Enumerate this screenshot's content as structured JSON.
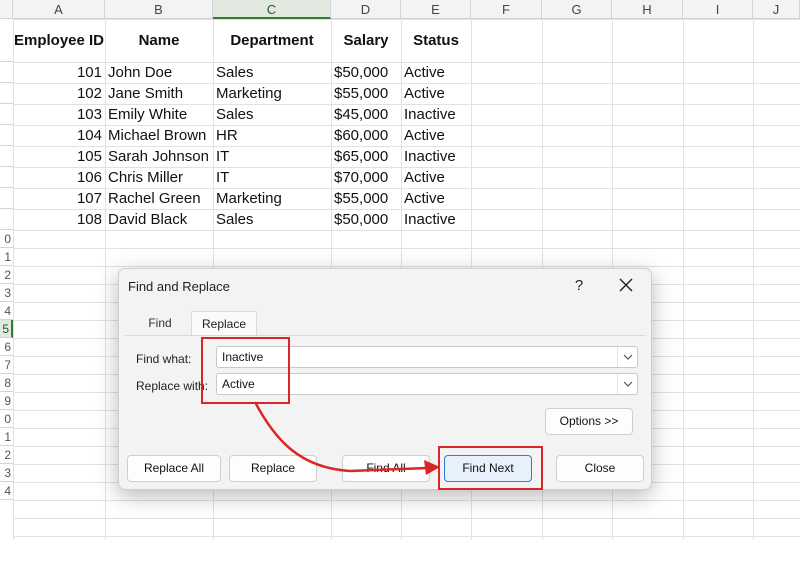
{
  "sheet": {
    "columns": [
      "A",
      "B",
      "C",
      "D",
      "E",
      "F",
      "G",
      "H",
      "I",
      "J"
    ],
    "selected_column": "C",
    "row_numbers": [
      "",
      "",
      "",
      "",
      "",
      "",
      "",
      "",
      "",
      "0",
      "1",
      "2",
      "3",
      "4",
      "5",
      "6",
      "7",
      "8",
      "9",
      "0",
      "1",
      "2",
      "3",
      "4"
    ],
    "selected_row_index": 14,
    "headers": {
      "employee_id": "Employee ID",
      "name": "Name",
      "department": "Department",
      "salary": "Salary",
      "status": "Status"
    },
    "rows": [
      {
        "id": "101",
        "name": "John Doe",
        "department": "Sales",
        "salary": "$50,000",
        "status": "Active"
      },
      {
        "id": "102",
        "name": "Jane Smith",
        "department": "Marketing",
        "salary": "$55,000",
        "status": "Active"
      },
      {
        "id": "103",
        "name": "Emily White",
        "department": "Sales",
        "salary": "$45,000",
        "status": "Inactive"
      },
      {
        "id": "104",
        "name": "Michael Brown",
        "department": "HR",
        "salary": "$60,000",
        "status": "Active"
      },
      {
        "id": "105",
        "name": "Sarah Johnson",
        "department": "IT",
        "salary": "$65,000",
        "status": "Inactive"
      },
      {
        "id": "106",
        "name": "Chris Miller",
        "department": "IT",
        "salary": "$70,000",
        "status": "Active"
      },
      {
        "id": "107",
        "name": "Rachel Green",
        "department": "Marketing",
        "salary": "$55,000",
        "status": "Active"
      },
      {
        "id": "108",
        "name": "David Black",
        "department": "Sales",
        "salary": "$50,000",
        "status": "Inactive"
      }
    ]
  },
  "dialog": {
    "title": "Find and Replace",
    "help_label": "?",
    "tabs": {
      "find": "Find",
      "replace": "Replace"
    },
    "active_tab": "replace",
    "find_what_label": "Find what:",
    "find_what_value": "Inactive",
    "replace_with_label": "Replace with:",
    "replace_with_value": "Active",
    "options_button": "Options >>",
    "buttons": {
      "replace_all": "Replace All",
      "replace": "Replace",
      "find_all": "Find All",
      "find_next": "Find Next",
      "close": "Close"
    }
  },
  "colors": {
    "annotation_red": "#d92628",
    "accent_blue": "#2f7ed4",
    "selection_green": "#2e7d32"
  },
  "icons": {
    "close": "close-icon",
    "dropdown": "chevron-down-icon",
    "arrow": "annotation-arrow-icon"
  }
}
